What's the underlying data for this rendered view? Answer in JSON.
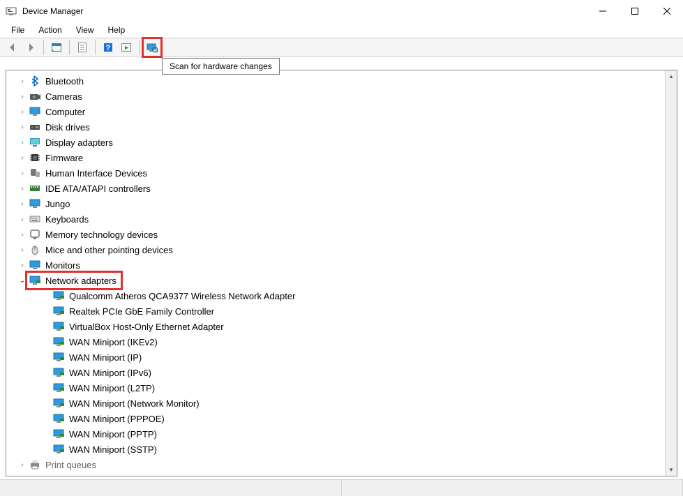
{
  "window": {
    "title": "Device Manager"
  },
  "menu": {
    "file": "File",
    "action": "Action",
    "view": "View",
    "help": "Help"
  },
  "toolbar": {
    "tooltip": "Scan for hardware changes"
  },
  "categories": [
    {
      "label": "Bluetooth",
      "icon": "bluetooth-icon",
      "expanded": false
    },
    {
      "label": "Cameras",
      "icon": "camera-icon",
      "expanded": false
    },
    {
      "label": "Computer",
      "icon": "monitor-icon",
      "expanded": false
    },
    {
      "label": "Disk drives",
      "icon": "disk-icon",
      "expanded": false
    },
    {
      "label": "Display adapters",
      "icon": "display-icon",
      "expanded": false
    },
    {
      "label": "Firmware",
      "icon": "chip-icon",
      "expanded": false
    },
    {
      "label": "Human Interface Devices",
      "icon": "hid-icon",
      "expanded": false
    },
    {
      "label": "IDE ATA/ATAPI controllers",
      "icon": "ide-icon",
      "expanded": false
    },
    {
      "label": "Jungo",
      "icon": "monitor-icon",
      "expanded": false
    },
    {
      "label": "Keyboards",
      "icon": "keyboard-icon",
      "expanded": false
    },
    {
      "label": "Memory technology devices",
      "icon": "memory-icon",
      "expanded": false
    },
    {
      "label": "Mice and other pointing devices",
      "icon": "mouse-icon",
      "expanded": false
    },
    {
      "label": "Monitors",
      "icon": "monitor-icon",
      "expanded": false
    },
    {
      "label": "Network adapters",
      "icon": "network-icon",
      "expanded": true,
      "highlighted": true
    },
    {
      "label": "Print queues",
      "icon": "printer-icon",
      "expanded": false,
      "cut": true
    }
  ],
  "network_children": [
    {
      "label": "Qualcomm Atheros QCA9377 Wireless Network Adapter"
    },
    {
      "label": "Realtek PCIe GbE Family Controller"
    },
    {
      "label": "VirtualBox Host-Only Ethernet Adapter"
    },
    {
      "label": "WAN Miniport (IKEv2)"
    },
    {
      "label": "WAN Miniport (IP)"
    },
    {
      "label": "WAN Miniport (IPv6)"
    },
    {
      "label": "WAN Miniport (L2TP)"
    },
    {
      "label": "WAN Miniport (Network Monitor)"
    },
    {
      "label": "WAN Miniport (PPPOE)"
    },
    {
      "label": "WAN Miniport (PPTP)"
    },
    {
      "label": "WAN Miniport (SSTP)"
    }
  ]
}
